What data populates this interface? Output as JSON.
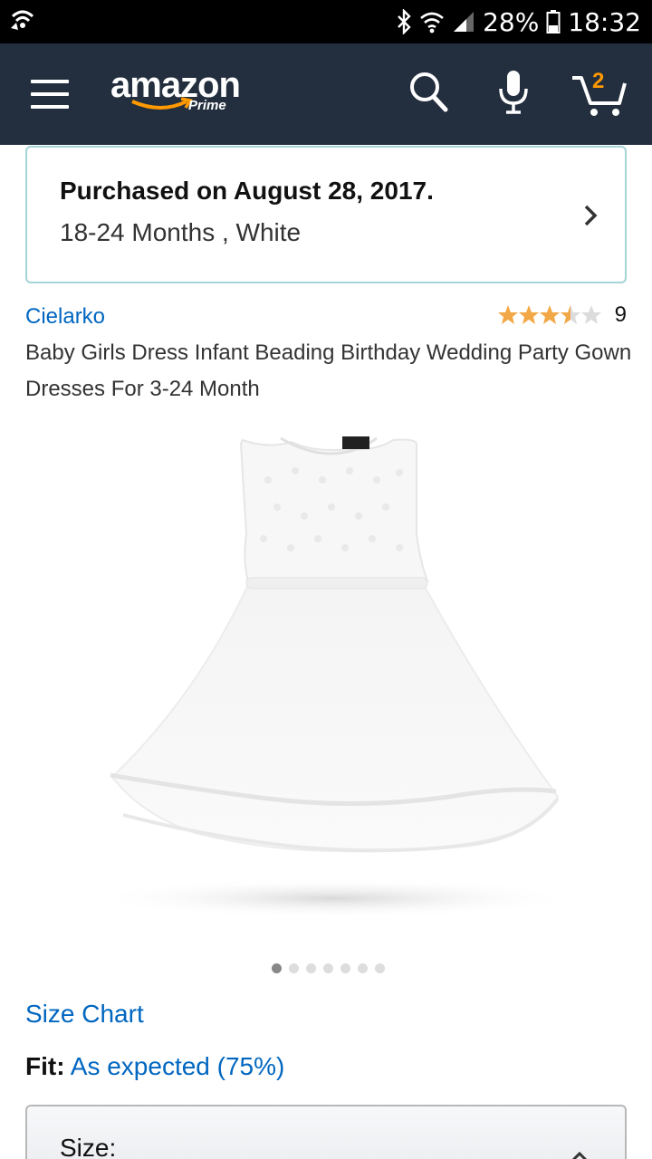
{
  "status_bar": {
    "battery_percent": "28%",
    "time": "18:32",
    "icons": [
      "wifi-call-icon",
      "bluetooth-icon",
      "wifi-icon",
      "signal-icon",
      "battery-icon"
    ]
  },
  "header": {
    "logo_text": "amazon",
    "logo_subtext": "Prime",
    "cart_count": "2",
    "icons": [
      "menu-icon",
      "search-icon",
      "microphone-icon",
      "cart-icon"
    ],
    "colors": {
      "background": "#232f3e",
      "accent": "#ff9900"
    }
  },
  "purchase": {
    "title": "Purchased on August 28, 2017.",
    "variant": "18-24 Months , White"
  },
  "product": {
    "brand": "Cielarko",
    "rating_stars": 3.5,
    "rating_count": "9",
    "title": "Baby Girls Dress Infant Beading Birthday Wedding Party Gown Dresses For 3-24 Month",
    "carousel": {
      "total": 7,
      "active": 1
    }
  },
  "size_chart_label": "Size Chart",
  "fit": {
    "label": "Fit:",
    "value": "As expected (75%)"
  },
  "size_selector": {
    "label": "Size:"
  }
}
